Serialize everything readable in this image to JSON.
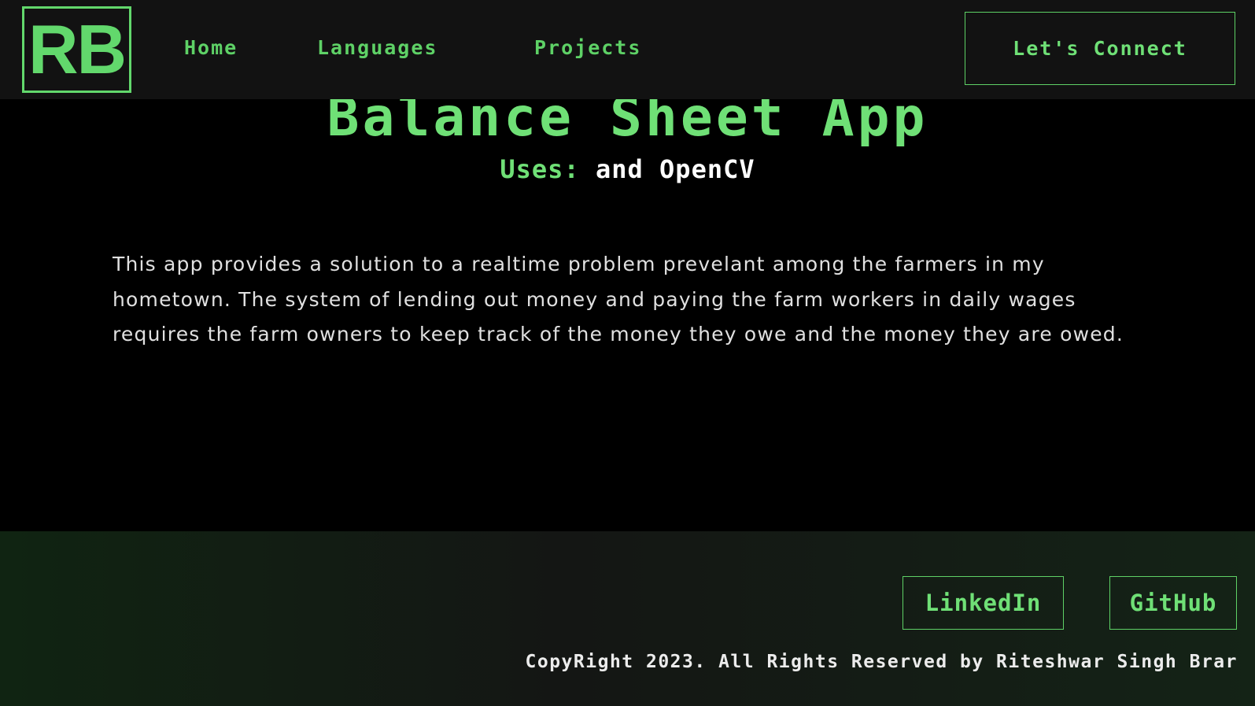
{
  "header": {
    "logo_text": "RB",
    "nav": [
      {
        "label": "Home"
      },
      {
        "label": "Languages"
      },
      {
        "label": "Projects"
      }
    ],
    "connect_label": "Let's Connect"
  },
  "project": {
    "title": "Balance Sheet App",
    "uses_label": "Uses:",
    "uses_value": "and OpenCV",
    "description": "This app provides a solution to a realtime problem prevelant among the farmers in my hometown. The system of lending out money and paying the farm workers in daily wages requires the farm owners to keep track of the money they owe and the money they are owed."
  },
  "footer": {
    "linkedin_label": "LinkedIn",
    "github_label": "GitHub",
    "copyright": "CopyRight 2023. All Rights Reserved by Riteshwar Singh Brar"
  },
  "colors": {
    "accent": "#6fe076",
    "navbar_bg": "#121212",
    "page_bg": "#000000",
    "footer_bg": "#141a14",
    "text": "#e0e0e0"
  }
}
